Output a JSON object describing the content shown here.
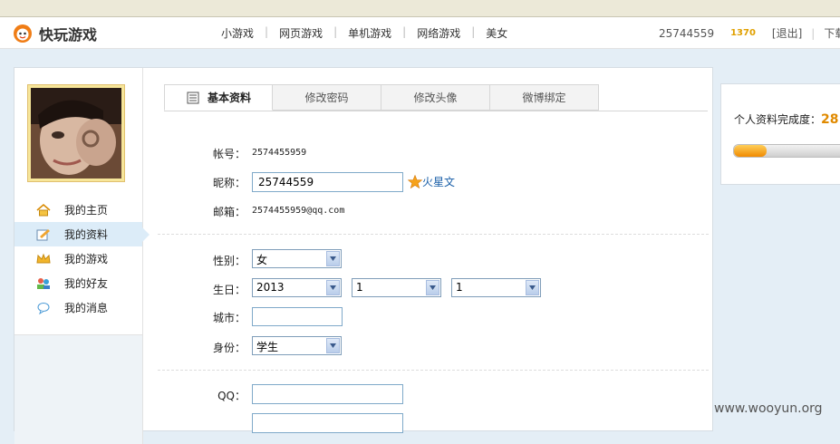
{
  "brand": {
    "name": "快玩游戏"
  },
  "nav": [
    {
      "label": "小游戏"
    },
    {
      "label": "网页游戏"
    },
    {
      "label": "单机游戏"
    },
    {
      "label": "网络游戏"
    },
    {
      "label": "美女"
    }
  ],
  "user": {
    "id": "25744559",
    "coins": "1370",
    "logout": "[退出]",
    "download": "下载"
  },
  "sidebar": {
    "items": [
      {
        "label": "我的主页",
        "icon": "home-icon"
      },
      {
        "label": "我的资料",
        "icon": "profile-edit-icon",
        "active": true
      },
      {
        "label": "我的游戏",
        "icon": "crown-icon"
      },
      {
        "label": "我的好友",
        "icon": "friends-icon"
      },
      {
        "label": "我的消息",
        "icon": "message-icon"
      }
    ]
  },
  "tabs": [
    {
      "label": "基本资料",
      "active": true
    },
    {
      "label": "修改密码"
    },
    {
      "label": "修改头像"
    },
    {
      "label": "微博绑定"
    }
  ],
  "form": {
    "account": {
      "label": "帐号：",
      "value": "2574455959"
    },
    "nickname": {
      "label": "昵称：",
      "value": "25744559",
      "star_text": "火星文"
    },
    "email": {
      "label": "邮箱：",
      "value": "2574455959@qq.com"
    },
    "gender": {
      "label": "性别：",
      "value": "女"
    },
    "birthday": {
      "label": "生日：",
      "year": "2013",
      "month": "1",
      "day": "1"
    },
    "city": {
      "label": "城市：",
      "value": ""
    },
    "identity": {
      "label": "身份：",
      "value": "学生"
    },
    "qq": {
      "label": "QQ：",
      "value": ""
    }
  },
  "completion": {
    "label": "个人资料完成度：",
    "percent_text": "28",
    "percent": 28
  },
  "watermark": "www.wooyun.org"
}
